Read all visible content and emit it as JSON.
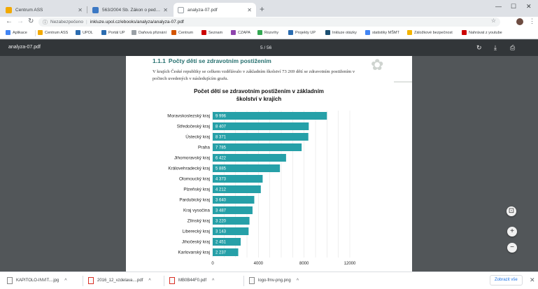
{
  "tabs": [
    {
      "title": "Centrum ASS",
      "favicon_color": "#f2a900",
      "active": false
    },
    {
      "title": "563/2004 Sb. Zákon o pedagogick",
      "favicon_color": "#3b78c4",
      "active": false
    },
    {
      "title": "analyza-07.pdf",
      "favicon_color": "#9aa0a6",
      "active": true
    }
  ],
  "omnibox": {
    "security": "Nezabezpečeno",
    "url": "inkluze.upol.cz/ebooks/analyza/analyza-07.pdf"
  },
  "bookmarks": [
    {
      "label": "Aplikace",
      "color": "#4285f4"
    },
    {
      "label": "Centrum ASS",
      "color": "#f2a900"
    },
    {
      "label": "UPOL",
      "color": "#2b6cb0"
    },
    {
      "label": "Portál UP",
      "color": "#2b6cb0"
    },
    {
      "label": "Daňová přiznání",
      "color": "#9aa0a6"
    },
    {
      "label": "Centrum",
      "color": "#d35400"
    },
    {
      "label": "Seznam",
      "color": "#cc0000"
    },
    {
      "label": "CZAPA",
      "color": "#8e44ad"
    },
    {
      "label": "Rozvrhy",
      "color": "#34a853"
    },
    {
      "label": "Projekty UP",
      "color": "#2b6cb0"
    },
    {
      "label": "Inkluze otázky",
      "color": "#1b4f72"
    },
    {
      "label": "statistiky MŠMT",
      "color": "#4285f4"
    },
    {
      "label": "Záložkové bezpečnost",
      "color": "#f4b400"
    },
    {
      "label": "Nahrávat z youtube",
      "color": "#cc0000"
    }
  ],
  "pdf": {
    "filename": "analyza-07.pdf",
    "page_indicator": "5 / 56"
  },
  "page": {
    "section_number": "1.1.1",
    "section_title": "Počty dětí se zdravotním postižením",
    "intro": "V krajích České republiky se celkem vzdělávalo v základním školství 73 269 dětí se zdravotním postižením v počtech uvedených v následujícím grafu."
  },
  "chart_data": {
    "type": "bar",
    "orientation": "horizontal",
    "title_line1": "Počet dětí se zdravotním postižením v základním",
    "title_line2": "školství v krajích",
    "categories": [
      "Moravskoslezský kraj",
      "Středočeský kraj",
      "Ústecký kraj",
      "Praha",
      "Jihomoravský kraj",
      "Královehradecký kraj",
      "Olomoucký kraj",
      "Plzeňský kraj",
      "Pardubický kraj",
      "Kraj vysočina",
      "Zlínský kraj",
      "Liberecký kraj",
      "Jihočeský kraj",
      "Karlovarský kraj"
    ],
    "values": [
      9996,
      8407,
      8371,
      7785,
      6422,
      5885,
      4373,
      4212,
      3640,
      3487,
      3220,
      3143,
      2451,
      2237
    ],
    "value_labels": [
      "9 996",
      "8 407",
      "8 371",
      "7 785",
      "6 422",
      "5 885",
      "4 373",
      "4 212",
      "3 640",
      "3 487",
      "3 220",
      "3 143",
      "2 451",
      "2 237"
    ],
    "xlim": [
      0,
      12000
    ],
    "xticks": [
      0,
      4000,
      8000,
      12000
    ],
    "bar_color": "#26a0a8",
    "grid": true
  },
  "downloads": [
    {
      "name": "KAPITOLO-INVIT....jpg",
      "type": "img"
    },
    {
      "name": "2016_12_vzdelava....pdf",
      "type": "pdf"
    },
    {
      "name": "MB0B44F0.pdf",
      "type": "pdf"
    },
    {
      "name": "logo-fmv-png.png",
      "type": "img"
    }
  ],
  "downloads_show_all": "Zobrazit vše"
}
